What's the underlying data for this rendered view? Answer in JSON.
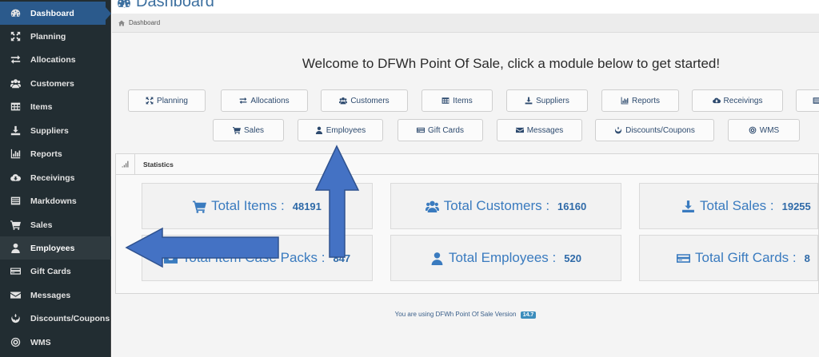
{
  "sidebar": {
    "items": [
      {
        "label": "Dashboard",
        "icon": "dashboard-icon"
      },
      {
        "label": "Planning",
        "icon": "arrows-icon"
      },
      {
        "label": "Allocations",
        "icon": "exchange-icon"
      },
      {
        "label": "Customers",
        "icon": "users-icon"
      },
      {
        "label": "Items",
        "icon": "table-icon"
      },
      {
        "label": "Suppliers",
        "icon": "download-icon"
      },
      {
        "label": "Reports",
        "icon": "bar-chart-icon"
      },
      {
        "label": "Receivings",
        "icon": "cloud-download-icon"
      },
      {
        "label": "Markdowns",
        "icon": "list-icon"
      },
      {
        "label": "Sales",
        "icon": "cart-icon"
      },
      {
        "label": "Employees",
        "icon": "user-icon"
      },
      {
        "label": "Gift Cards",
        "icon": "credit-card-icon"
      },
      {
        "label": "Messages",
        "icon": "envelope-icon"
      },
      {
        "label": "Discounts/Coupons",
        "icon": "rebel-icon"
      },
      {
        "label": "WMS",
        "icon": "gear-icon"
      }
    ]
  },
  "header": {
    "title": "Dashboard",
    "breadcrumb": "Dashboard"
  },
  "welcome": "Welcome to DFWh Point Of Sale, click a module below to get started!",
  "modules_row1": [
    {
      "label": "Planning",
      "icon": "arrows-icon"
    },
    {
      "label": "Allocations",
      "icon": "exchange-icon"
    },
    {
      "label": "Customers",
      "icon": "users-icon"
    },
    {
      "label": "Items",
      "icon": "table-icon"
    },
    {
      "label": "Suppliers",
      "icon": "download-icon"
    },
    {
      "label": "Reports",
      "icon": "bar-chart-icon"
    },
    {
      "label": "Receivings",
      "icon": "cloud-download-icon"
    },
    {
      "label": "",
      "icon": "list-icon"
    }
  ],
  "modules_row2": [
    {
      "label": "Sales",
      "icon": "cart-icon"
    },
    {
      "label": "Employees",
      "icon": "user-icon"
    },
    {
      "label": "Gift Cards",
      "icon": "credit-card-icon"
    },
    {
      "label": "Messages",
      "icon": "envelope-icon"
    },
    {
      "label": "Discounts/Coupons",
      "icon": "rebel-icon"
    },
    {
      "label": "WMS",
      "icon": "gear-icon"
    }
  ],
  "statistics": {
    "title": "Statistics",
    "boxes": [
      {
        "label": "Total Items :",
        "value": "48191",
        "icon": "cart-icon"
      },
      {
        "label": "Total Customers :",
        "value": "16160",
        "icon": "users-icon"
      },
      {
        "label": "Total Sales :",
        "value": "19255",
        "icon": "download-icon"
      },
      {
        "label": "Total Item Case Packs :",
        "value": "847",
        "icon": "inbox-icon"
      },
      {
        "label": "Total Employees :",
        "value": "520",
        "icon": "user-icon"
      },
      {
        "label": "Total Gift Cards :",
        "value": "8",
        "icon": "credit-card-icon"
      }
    ]
  },
  "footer": {
    "text": "You are using DFWh Point Of Sale Version",
    "version": "14.7"
  },
  "colors": {
    "sidebar_bg": "#222d32",
    "active_bg": "#2b5a8c",
    "accent": "#3a7bbf",
    "arrow_fill": "#4472c4",
    "arrow_stroke": "#2f528f"
  }
}
